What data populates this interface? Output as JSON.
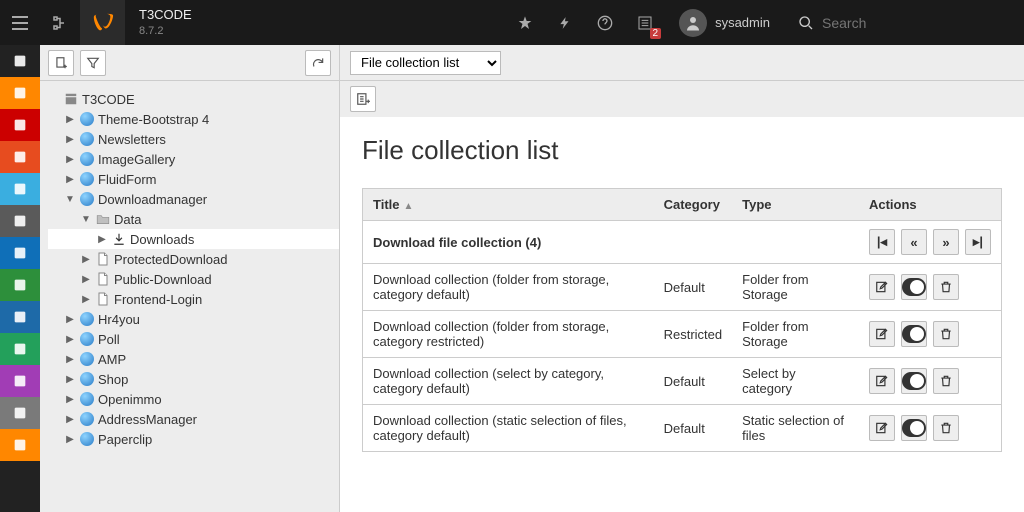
{
  "header": {
    "brand_name": "T3CODE",
    "version": "8.7.2",
    "notification_count": "2",
    "username": "sysadmin",
    "search_placeholder": "Search"
  },
  "module_colors": [
    "#222",
    "#ff8700",
    "#cc0000",
    "#e74c1f",
    "#3aaee0",
    "#5a5a5a",
    "#0f6fb8",
    "#2d8f3b",
    "#1e6aa8",
    "#23a05b",
    "#a13db5",
    "#7a7a7a",
    "#ff8700"
  ],
  "tree_toolbar": {
    "new_label": "new",
    "filter_label": "filter",
    "refresh_label": "refresh"
  },
  "tree": {
    "root": "T3CODE",
    "nodes": [
      {
        "label": "Theme-Bootstrap 4",
        "depth": 1,
        "icon": "globe"
      },
      {
        "label": "Newsletters",
        "depth": 1,
        "icon": "globe"
      },
      {
        "label": "ImageGallery",
        "depth": 1,
        "icon": "globe"
      },
      {
        "label": "FluidForm",
        "depth": 1,
        "icon": "globe"
      },
      {
        "label": "Downloadmanager",
        "depth": 1,
        "icon": "globe",
        "expanded": true
      },
      {
        "label": "Data",
        "depth": 2,
        "icon": "folder",
        "expanded": true
      },
      {
        "label": "Downloads",
        "depth": 3,
        "icon": "download",
        "selected": true
      },
      {
        "label": "ProtectedDownload",
        "depth": 2,
        "icon": "page"
      },
      {
        "label": "Public-Download",
        "depth": 2,
        "icon": "page"
      },
      {
        "label": "Frontend-Login",
        "depth": 2,
        "icon": "page"
      },
      {
        "label": "Hr4you",
        "depth": 1,
        "icon": "globe"
      },
      {
        "label": "Poll",
        "depth": 1,
        "icon": "globe"
      },
      {
        "label": "AMP",
        "depth": 1,
        "icon": "globe"
      },
      {
        "label": "Shop",
        "depth": 1,
        "icon": "globe"
      },
      {
        "label": "Openimmo",
        "depth": 1,
        "icon": "globe"
      },
      {
        "label": "AddressManager",
        "depth": 1,
        "icon": "globe"
      },
      {
        "label": "Paperclip",
        "depth": 1,
        "icon": "globe"
      }
    ]
  },
  "content": {
    "dropdown_value": "File collection list",
    "page_title": "File collection list",
    "columns": {
      "title": "Title",
      "category": "Category",
      "type": "Type",
      "actions": "Actions"
    },
    "group_label": "Download file collection (4)",
    "rows": [
      {
        "title": "Download collection (folder from storage, category default)",
        "category": "Default",
        "type": "Folder from Storage"
      },
      {
        "title": "Download collection (folder from storage, category restricted)",
        "category": "Restricted",
        "type": "Folder from Storage"
      },
      {
        "title": "Download collection (select by category, category default)",
        "category": "Default",
        "type": "Select by category"
      },
      {
        "title": "Download collection (static selection of files, category default)",
        "category": "Default",
        "type": "Static selection of files"
      }
    ]
  }
}
